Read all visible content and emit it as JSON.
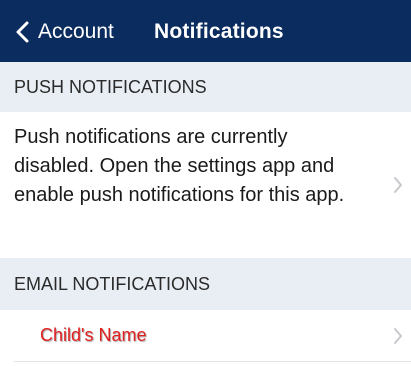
{
  "navbar": {
    "back_label": "Account",
    "title": "Notifications",
    "back_icon": "chevron-left-icon"
  },
  "sections": {
    "push": {
      "header": "PUSH NOTIFICATIONS",
      "message": "Push notifications are currently disabled. Open the settings app and enable push notifications for this app."
    },
    "email": {
      "header": "EMAIL NOTIFICATIONS",
      "items": [
        {
          "label": "Child's Name"
        }
      ]
    }
  },
  "colors": {
    "navbar_bg": "#0b2c5e",
    "section_header_bg": "#e8eef4",
    "child_name_text": "#e02020",
    "chevron": "#c7c7cc"
  }
}
